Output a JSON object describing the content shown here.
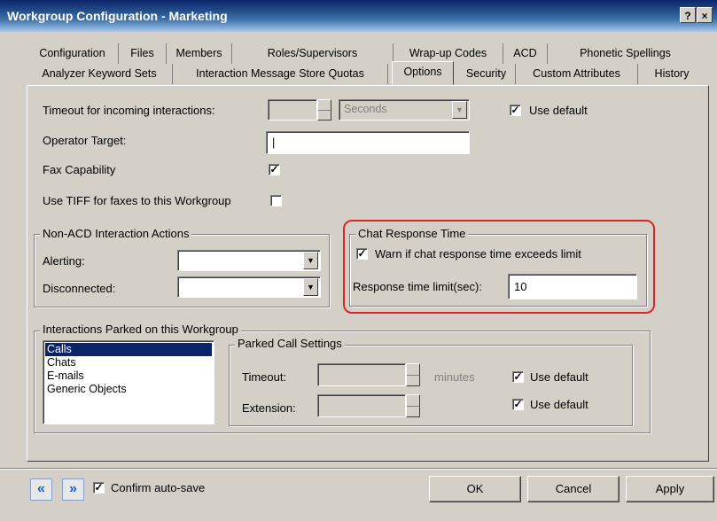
{
  "window": {
    "title": "Workgroup Configuration - Marketing",
    "help_label": "?",
    "close_label": "×"
  },
  "tabs": {
    "row1": [
      "Configuration",
      "Files",
      "Members",
      "Roles/Supervisors",
      "Wrap-up Codes",
      "ACD",
      "Phonetic Spellings"
    ],
    "row2": [
      "Analyzer Keyword Sets",
      "Interaction Message Store Quotas",
      "Options",
      "Security",
      "Custom Attributes",
      "History"
    ],
    "active": "Options"
  },
  "options": {
    "timeout_label": "Timeout for incoming interactions:",
    "timeout_value": "",
    "timeout_unit": "Seconds",
    "timeout_use_default_label": "Use default",
    "timeout_use_default_checked": true,
    "operator_target_label": "Operator Target:",
    "operator_target_value": "|",
    "fax_label": "Fax Capability",
    "fax_checked": true,
    "tiff_label": "Use TIFF for faxes to this Workgroup",
    "tiff_checked": false
  },
  "non_acd": {
    "legend": "Non-ACD Interaction Actions",
    "alerting_label": "Alerting:",
    "alerting_value": "",
    "disconnected_label": "Disconnected:",
    "disconnected_value": ""
  },
  "chat_response": {
    "legend": "Chat Response Time",
    "warn_label": "Warn if chat response time exceeds limit",
    "warn_checked": true,
    "limit_label": "Response time limit(sec):",
    "limit_value": "10",
    "highlight_color": "#d9262b"
  },
  "parked": {
    "legend": "Interactions Parked on this Workgroup",
    "list": [
      "Calls",
      "Chats",
      "E-mails",
      "Generic Objects"
    ],
    "selected": "Calls",
    "settings_legend": "Parked Call Settings",
    "timeout_label": "Timeout:",
    "timeout_value": "",
    "minutes_label": "minutes",
    "timeout_use_default_label": "Use default",
    "timeout_use_default_checked": true,
    "extension_label": "Extension:",
    "extension_value": "",
    "extension_use_default_label": "Use default",
    "extension_use_default_checked": true
  },
  "footer": {
    "prev_icon": "«",
    "next_icon": "»",
    "confirm_label": "Confirm auto-save",
    "confirm_checked": true,
    "ok_label": "OK",
    "cancel_label": "Cancel",
    "apply_label": "Apply"
  },
  "check_mark": "✓",
  "dropdown_arrow": "▼"
}
